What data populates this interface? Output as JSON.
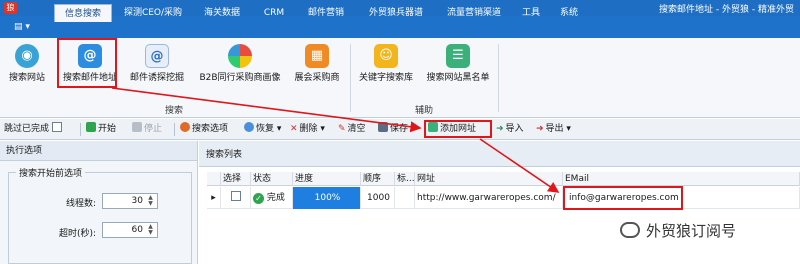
{
  "window": {
    "app_icon": "狼",
    "title": "搜索邮件地址 - 外贸狼 - 精准外贸"
  },
  "tabs": [
    {
      "label": "信息搜索"
    },
    {
      "label": "探测CEO/采购"
    },
    {
      "label": "海关数据"
    },
    {
      "label": "CRM"
    },
    {
      "label": "邮件营销"
    },
    {
      "label": "外贸狼兵器谱"
    },
    {
      "label": "流量营销渠道"
    },
    {
      "label": "工具"
    },
    {
      "label": "系统"
    }
  ],
  "menu_button": "▤ ▾",
  "ribbon": {
    "buttons": [
      {
        "label": "搜索网站",
        "icon": "globe-icon"
      },
      {
        "label": "搜索邮件地址",
        "icon": "at-sign-icon"
      },
      {
        "label": "邮件诱探挖掘",
        "icon": "at-mail-icon"
      },
      {
        "label": "B2B同行采购商画像",
        "icon": "pie-chart-icon"
      },
      {
        "label": "展会采购商",
        "icon": "exhibition-icon"
      },
      {
        "label": "关键字搜索库",
        "icon": "keyword-library-icon"
      },
      {
        "label": "搜索网站黑名单",
        "icon": "blacklist-icon"
      }
    ],
    "groups": {
      "search": "搜索",
      "assist": "辅助"
    }
  },
  "toolbar": {
    "skip_done": "跳过已完成",
    "start": "开始",
    "stop": "停止",
    "search_options": "搜索选项",
    "restore": "恢复",
    "delete": "删除",
    "clear": "清空",
    "save": "保存",
    "add_url": "添加网址",
    "import": "导入",
    "export": "导出"
  },
  "left_panel": {
    "header": "执行选项",
    "group_title": "搜索开始前选项",
    "threads_label": "线程数:",
    "threads_value": "30",
    "timeout_label": "超时(秒):",
    "timeout_value": "60"
  },
  "right_panel": {
    "header": "搜索列表",
    "columns": [
      "选择",
      "状态",
      "进度",
      "顺序",
      "标...",
      "网址",
      "EMail"
    ],
    "row": {
      "status": "完成",
      "progress": "100%",
      "order": "1000",
      "url": "http://www.garwareropes.com/",
      "email": "info@garwareropes.com"
    }
  },
  "watermark": "外贸狼订阅号",
  "colors": {
    "accent": "#1f72c9",
    "highlight": "#e0161b",
    "progress": "#1f7fe0",
    "done": "#2ea44f"
  }
}
